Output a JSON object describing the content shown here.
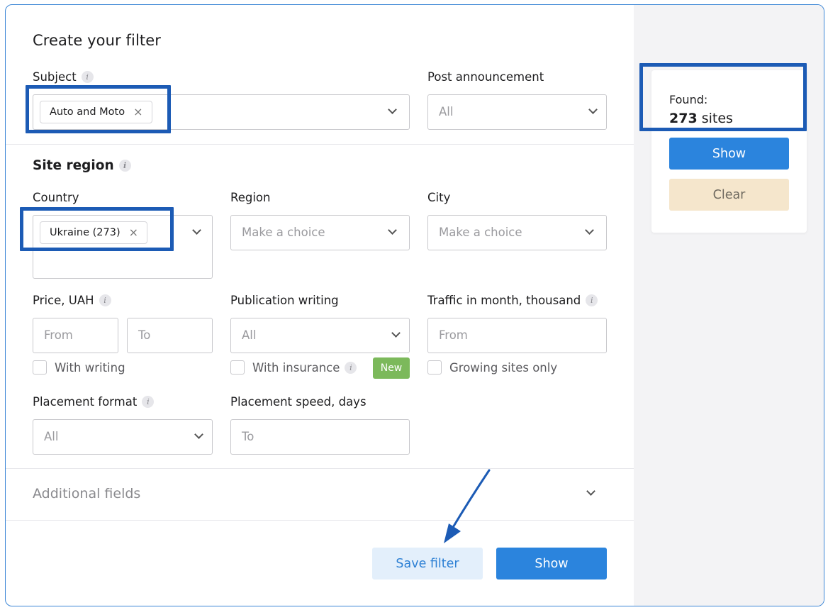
{
  "form": {
    "title": "Create your filter",
    "subject": {
      "label": "Subject",
      "chip": "Auto and Moto",
      "chip_remove": "×"
    },
    "post_announcement": {
      "label": "Post announcement",
      "value": "All"
    },
    "site_region": {
      "heading": "Site region",
      "country": {
        "label": "Country",
        "chip": "Ukraine (273)",
        "chip_remove": "×"
      },
      "region": {
        "label": "Region",
        "placeholder": "Make a choice"
      },
      "city": {
        "label": "City",
        "placeholder": "Make a choice"
      }
    },
    "price": {
      "label": "Price, UAH",
      "from": "From",
      "to": "To",
      "checkbox": "With writing"
    },
    "publication_writing": {
      "label": "Publication writing",
      "value": "All",
      "checkbox": "With insurance",
      "badge": "New"
    },
    "traffic": {
      "label": "Traffic in month, thousand",
      "from": "From",
      "checkbox": "Growing sites only"
    },
    "placement_format": {
      "label": "Placement format",
      "value": "All"
    },
    "placement_speed": {
      "label": "Placement speed, days",
      "to": "To"
    },
    "additional_fields": "Additional fields",
    "buttons": {
      "save": "Save filter",
      "show": "Show"
    }
  },
  "sidebar": {
    "found_label": "Found:",
    "count": "273",
    "count_unit": "sites",
    "show": "Show",
    "clear": "Clear"
  },
  "colors": {
    "primary": "#2b84dd",
    "highlight": "#1c5bb5",
    "badge_new": "#7cb95b",
    "clear_bg": "#f5e6cc",
    "save_bg": "#e3effb"
  },
  "icons": [
    "info-icon",
    "chevron-down-icon",
    "close-icon",
    "arrow-annotation"
  ]
}
